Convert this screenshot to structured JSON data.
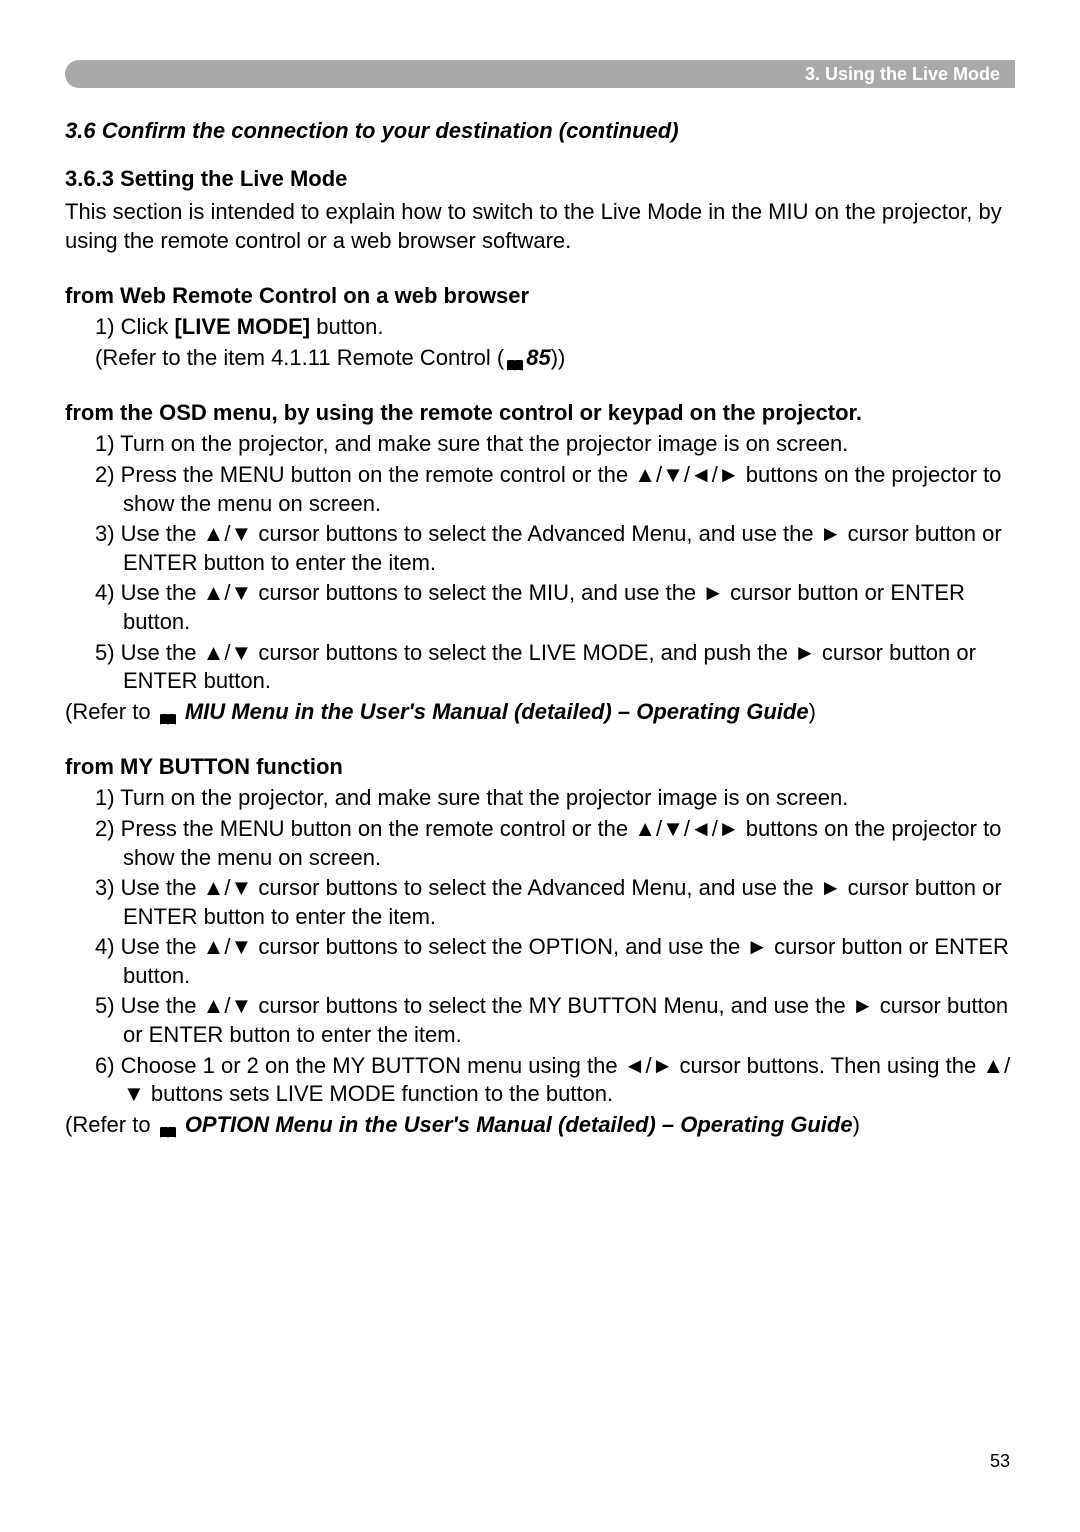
{
  "header": {
    "chapter": "3. Using the Live Mode"
  },
  "section": {
    "title": "3.6 Confirm the connection to your destination (continued)"
  },
  "subsection": {
    "title": "3.6.3 Setting the Live Mode",
    "intro": "This section is intended to explain how to switch to the Live Mode in the MIU on the projector, by using the remote control or a web browser software."
  },
  "methodA": {
    "title": "from Web Remote Control on a web browser",
    "step1_pre": "1) Click ",
    "step1_bold": "[LIVE MODE]",
    "step1_post": " button.",
    "refer_pre": "(Refer to the item 4.1.11 Remote Control (",
    "refer_page": "85",
    "refer_post": "))"
  },
  "methodB": {
    "title": "from the OSD menu, by using the remote control or keypad on the projector.",
    "step1": "1) Turn on the projector, and make sure that the projector image is on screen.",
    "step2": "2) Press the MENU button on the remote control or the ▲/▼/◄/► buttons on the projector to show the menu on screen.",
    "step3": "3) Use the ▲/▼ cursor buttons to select the Advanced Menu, and use the ► cursor button or ENTER button to enter the item.",
    "step4": "4) Use the ▲/▼ cursor buttons to select the MIU, and use the ► cursor button or ENTER button.",
    "step5": "5) Use the ▲/▼ cursor buttons to select the LIVE MODE, and push the ► cursor button or ENTER button.",
    "refer_pre": "(Refer to ",
    "refer_bold": " MIU Menu in the User's Manual (detailed) – Operating Guide",
    "refer_post": ")"
  },
  "methodC": {
    "title": "from MY BUTTON function",
    "step1": "1) Turn on the projector, and make sure that the projector image is on screen.",
    "step2": "2) Press the MENU button on the remote control or the ▲/▼/◄/► buttons on the projector to show the menu on screen.",
    "step3": "3) Use the ▲/▼ cursor buttons to select the Advanced Menu, and use the ► cursor button or ENTER button to enter the item.",
    "step4": "4) Use the ▲/▼ cursor buttons to select the OPTION, and use the ► cursor button or ENTER button.",
    "step5": "5) Use the ▲/▼ cursor buttons to select the MY BUTTON Menu, and use the ► cursor button or ENTER button to enter the item.",
    "step6": "6) Choose 1 or 2 on the MY BUTTON menu using the ◄/► cursor buttons. Then using the ▲/▼ buttons sets LIVE MODE function to the button.",
    "refer_pre": "(Refer to ",
    "refer_bold": " OPTION Menu in the User's Manual (detailed) – Operating Guide",
    "refer_post": ")"
  },
  "pageNumber": "53"
}
